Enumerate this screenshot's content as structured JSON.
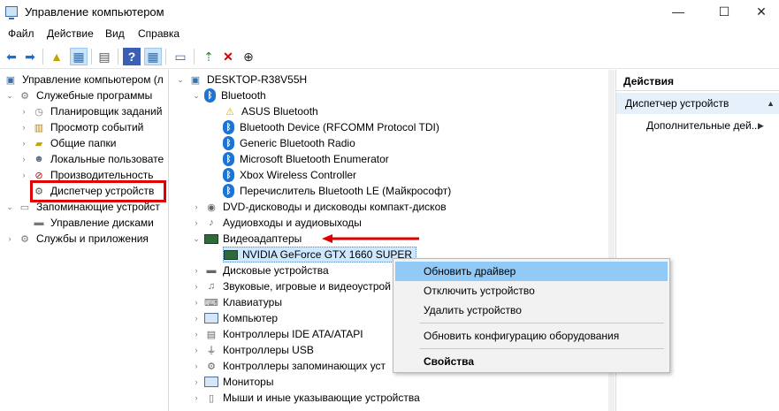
{
  "window": {
    "title": "Управление компьютером",
    "controls": [
      "—",
      "☐",
      "✕"
    ]
  },
  "menu": [
    "Файл",
    "Действие",
    "Вид",
    "Справка"
  ],
  "left_tree": {
    "root": "Управление компьютером (л",
    "items": [
      {
        "label": "Служебные программы"
      },
      {
        "label": "Планировщик заданий"
      },
      {
        "label": "Просмотр событий"
      },
      {
        "label": "Общие папки"
      },
      {
        "label": "Локальные пользовате"
      },
      {
        "label": "Производительность"
      },
      {
        "label": "Диспетчер устройств"
      },
      {
        "label": "Запоминающие устройст"
      },
      {
        "label": "Управление дисками"
      },
      {
        "label": "Службы и приложения"
      }
    ]
  },
  "device_tree": {
    "computer": "DESKTOP-R38V55H",
    "bluetooth": {
      "label": "Bluetooth",
      "children": [
        "ASUS Bluetooth",
        "Bluetooth Device (RFCOMM Protocol TDI)",
        "Generic Bluetooth Radio",
        "Microsoft Bluetooth Enumerator",
        "Xbox Wireless Controller",
        "Перечислитель Bluetooth LE (Майкрософт)"
      ]
    },
    "categories_before": [
      "DVD-дисководы и дисководы компакт-дисков",
      "Аудиовходы и аудиовыходы"
    ],
    "video": {
      "label": "Видеоадаптеры",
      "child": "NVIDIA GeForce GTX 1660 SUPER"
    },
    "categories_after": [
      "Дисковые устройства",
      "Звуковые, игровые и видеоустрой",
      "Клавиатуры",
      "Компьютер",
      "Контроллеры IDE ATA/ATAPI",
      "Контроллеры USB",
      "Контроллеры запоминающих уст",
      "Мониторы",
      "Мыши и иные указывающие устройства"
    ]
  },
  "actions": {
    "header": "Действия",
    "section": "Диспетчер устройств",
    "more": "Дополнительные дей..."
  },
  "context_menu": {
    "items": [
      "Обновить драйвер",
      "Отключить устройство",
      "Удалить устройство",
      "Обновить конфигурацию оборудования",
      "Свойства"
    ]
  },
  "colors": {
    "highlight_red": "#e00000",
    "bluetooth_blue": "#1e74d2",
    "menu_hover": "#91c9f7"
  }
}
